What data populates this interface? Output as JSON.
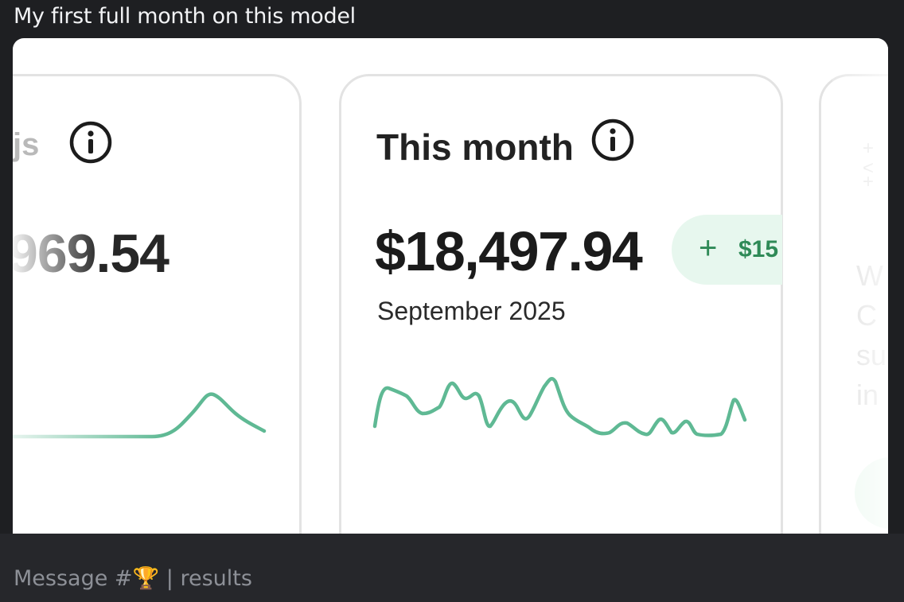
{
  "message": {
    "caption": "My first full month on this model"
  },
  "cards": {
    "left": {
      "label_partial": "js",
      "value_partial": "969.54"
    },
    "middle": {
      "title": "This month",
      "value": "$18,497.94",
      "period": "September 2025",
      "delta_plus": "+",
      "delta_partial": "$15"
    },
    "right": {
      "symbols": [
        "+",
        "<",
        "+"
      ],
      "text_fragments": [
        "W",
        "C",
        "su",
        "in"
      ]
    }
  },
  "composer": {
    "placeholder_prefix": "Message #",
    "channel_emoji": "🏆",
    "separator": "|",
    "placeholder_suffix": "results"
  },
  "colors": {
    "sparkline": "#5fb994",
    "delta": "#2f8a57",
    "pill_bg": "#e7f7ee"
  }
}
